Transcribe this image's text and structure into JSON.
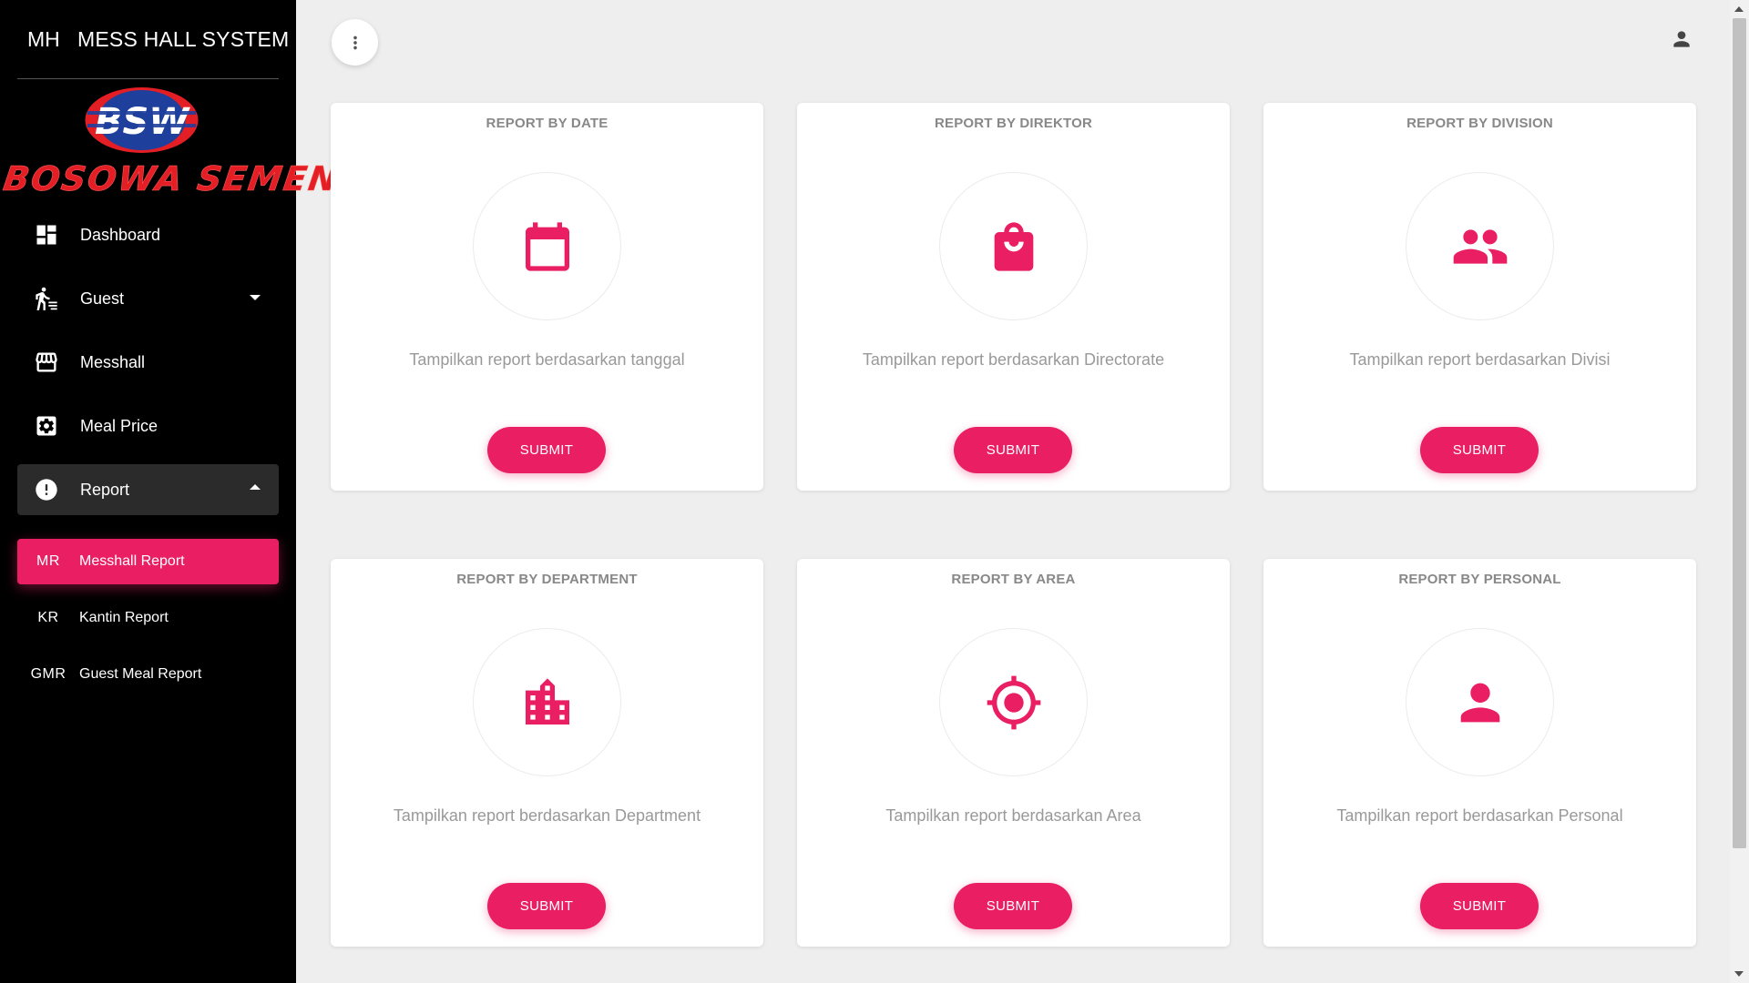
{
  "brand": {
    "mini": "MH",
    "name": "MESS HALL SYSTEM",
    "logo_oval_text": "BSW",
    "logo_text": "BOSOWA SEMEN"
  },
  "nav": {
    "items": [
      {
        "label": "Dashboard",
        "icon": "dashboard-icon"
      },
      {
        "label": "Guest",
        "icon": "guest-icon"
      },
      {
        "label": "Messhall",
        "icon": "store-icon"
      },
      {
        "label": "Meal Price",
        "icon": "settings-box-icon"
      },
      {
        "label": "Report",
        "icon": "alert-circle-icon"
      }
    ],
    "sub_items": [
      {
        "abbr": "MR",
        "label": "Messhall Report"
      },
      {
        "abbr": "KR",
        "label": "Kantin Report"
      },
      {
        "abbr": "GMR",
        "label": "Guest Meal Report"
      }
    ]
  },
  "cards": [
    {
      "title": "REPORT BY DATE",
      "description": "Tampilkan report berdasarkan tanggal",
      "button": "SUBMIT",
      "icon": "calendar-icon"
    },
    {
      "title": "REPORT BY DIREKTOR",
      "description": "Tampilkan report berdasarkan Directorate",
      "button": "SUBMIT",
      "icon": "bag-icon"
    },
    {
      "title": "REPORT BY DIVISION",
      "description": "Tampilkan report berdasarkan Divisi",
      "button": "SUBMIT",
      "icon": "group-icon"
    },
    {
      "title": "REPORT BY DEPARTMENT",
      "description": "Tampilkan report berdasarkan Department",
      "button": "SUBMIT",
      "icon": "building-icon"
    },
    {
      "title": "REPORT BY AREA",
      "description": "Tampilkan report berdasarkan Area",
      "button": "SUBMIT",
      "icon": "target-icon"
    },
    {
      "title": "REPORT BY PERSONAL",
      "description": "Tampilkan report berdasarkan Personal",
      "button": "SUBMIT",
      "icon": "person-icon"
    }
  ],
  "colors": {
    "accent": "#e91e63",
    "sidebar_bg": "#000000",
    "page_bg": "#eeeeee"
  }
}
